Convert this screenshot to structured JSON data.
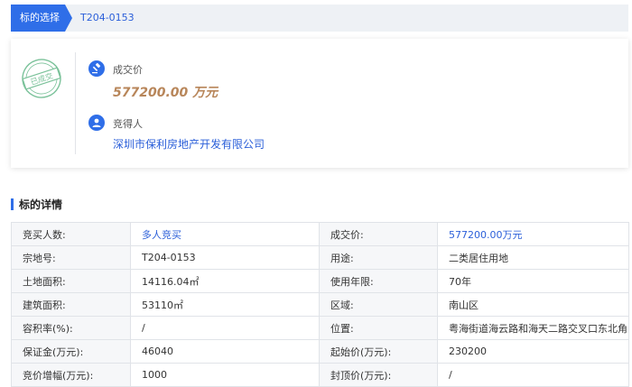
{
  "breadcrumb": {
    "active": "标的选择",
    "current": "T204-0153"
  },
  "summary": {
    "stamp_text": "已成交",
    "price_label": "成交价",
    "price_value": "577200.00 万元",
    "winner_label": "竞得人",
    "winner_value": "深圳市保利房地产开发有限公司"
  },
  "details": {
    "title": "标的详情",
    "rows": [
      {
        "l1": "竞买人数:",
        "v1": "多人竞买",
        "l2": "成交价:",
        "v2": "577200.00万元"
      },
      {
        "l1": "宗地号:",
        "v1": "T204-0153",
        "l2": "用途:",
        "v2": "二类居住用地"
      },
      {
        "l1": "土地面积:",
        "v1": "14116.04㎡",
        "l2": "使用年限:",
        "v2": "70年"
      },
      {
        "l1": "建筑面积:",
        "v1": "53110㎡",
        "l2": "区域:",
        "v2": "南山区"
      },
      {
        "l1": "容积率(%):",
        "v1": "/",
        "l2": "位置:",
        "v2": "粤海街道海云路和海天二路交叉口东北角"
      },
      {
        "l1": "保证金(万元):",
        "v1": "46040",
        "l2": "起始价(万元):",
        "v2": "230200"
      },
      {
        "l1": "竞价增幅(万元):",
        "v1": "1000",
        "l2": "封顶价(万元):",
        "v2": "/"
      }
    ]
  },
  "colors": {
    "accent": "#2f6ee8",
    "price": "#b8865a",
    "stamp": "#7bc29a"
  }
}
